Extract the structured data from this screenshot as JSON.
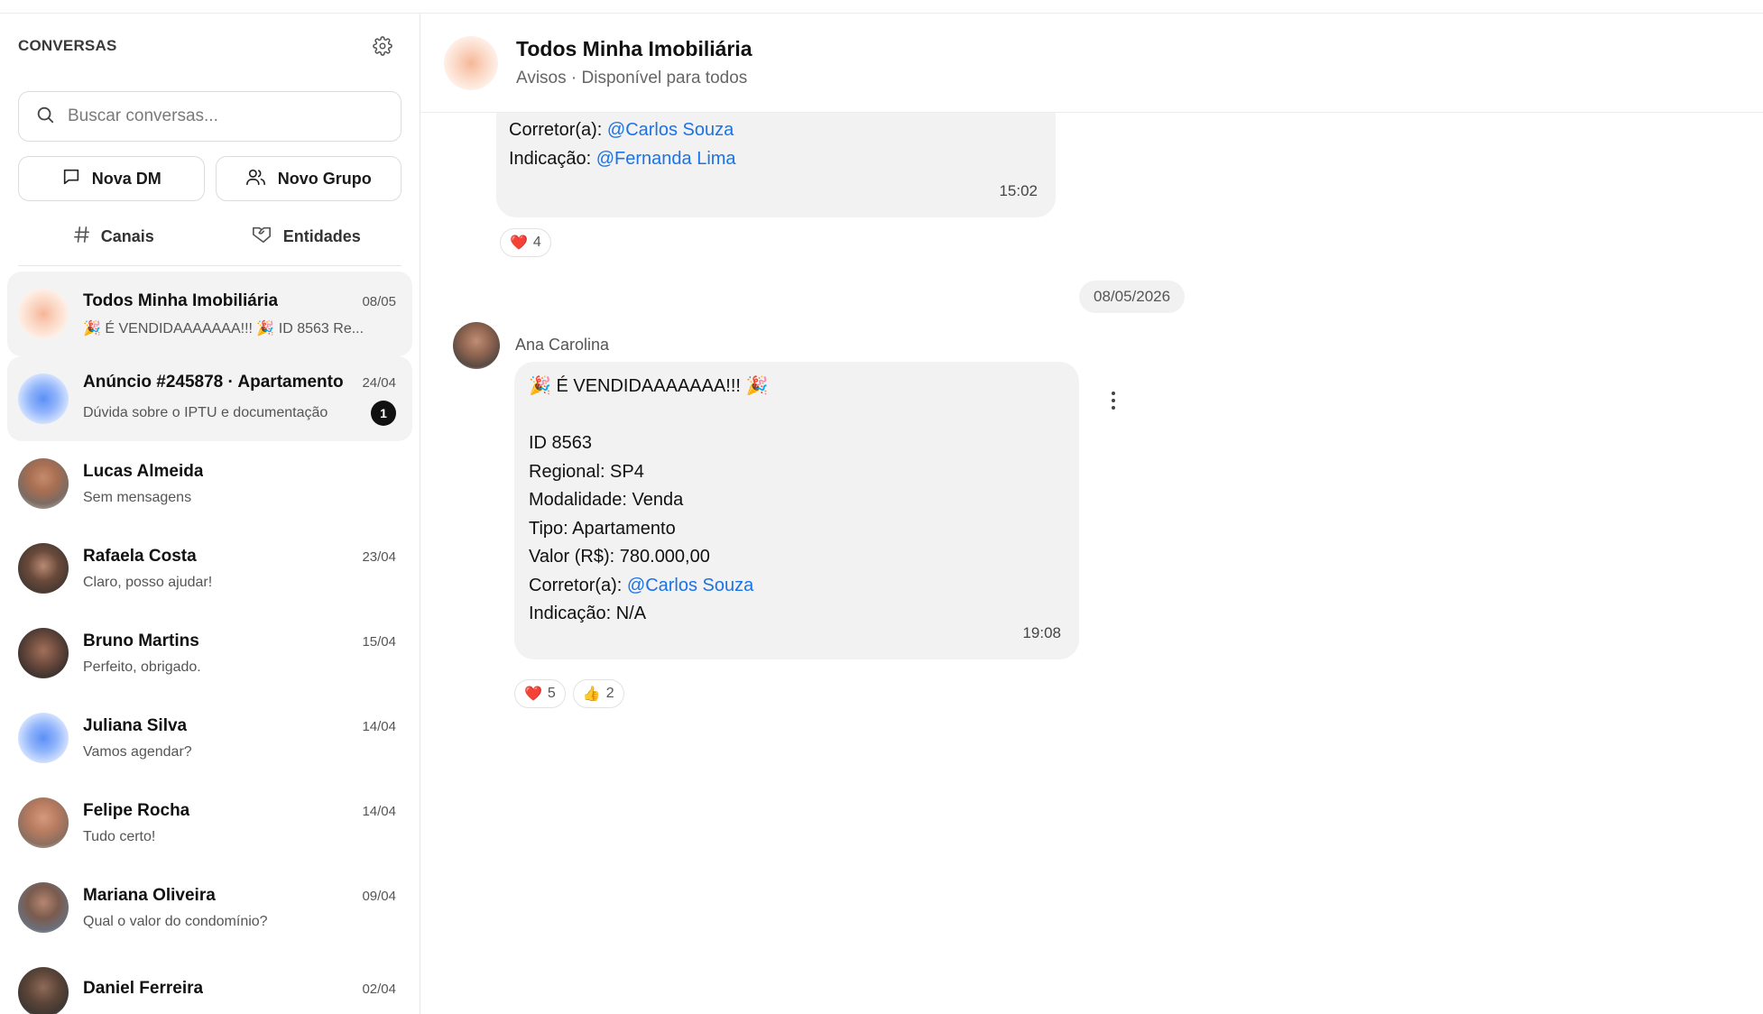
{
  "sidebar": {
    "title": "CONVERSAS",
    "search_placeholder": "Buscar conversas...",
    "new_dm_label": "Nova DM",
    "new_group_label": "Novo Grupo",
    "channels_label": "Canais",
    "entities_label": "Entidades",
    "conversations": [
      {
        "name": "Todos Minha Imobiliária",
        "time": "08/05",
        "preview": "🎉 É VENDIDAAAAAAA!!! 🎉 ID 8563 Re...",
        "badge": ""
      },
      {
        "name": "Anúncio #245878 · Apartamento",
        "time": "24/04",
        "preview": "Dúvida sobre o IPTU e documentação",
        "badge": "1"
      },
      {
        "name": "Lucas Almeida",
        "time": "",
        "preview": "Sem mensagens",
        "badge": ""
      },
      {
        "name": "Rafaela Costa",
        "time": "23/04",
        "preview": "Claro, posso ajudar!",
        "badge": ""
      },
      {
        "name": "Bruno Martins",
        "time": "15/04",
        "preview": "Perfeito, obrigado.",
        "badge": ""
      },
      {
        "name": "Juliana Silva",
        "time": "14/04",
        "preview": "Vamos agendar?",
        "badge": ""
      },
      {
        "name": "Felipe Rocha",
        "time": "14/04",
        "preview": "Tudo certo!",
        "badge": ""
      },
      {
        "name": "Mariana Oliveira",
        "time": "09/04",
        "preview": "Qual o valor do condomínio?",
        "badge": ""
      },
      {
        "name": "Daniel Ferreira",
        "time": "02/04",
        "preview": "",
        "badge": ""
      }
    ]
  },
  "chat": {
    "title": "Todos Minha Imobiliária",
    "subtitle": "Avisos · Disponível para todos",
    "msg1": {
      "broker_label": "Corretor(a): ",
      "broker_mention": "@Carlos Souza",
      "referral_label": "Indicação: ",
      "referral_mention": "@Fernanda Lima",
      "time": "15:02",
      "reactions": [
        {
          "emoji": "❤️",
          "count": "4"
        }
      ]
    },
    "date_divider": "08/05/2026",
    "msg2": {
      "sender": "Ana Carolina",
      "headline": "🎉 É VENDIDAAAAAAA!!! 🎉",
      "id_line": "ID 8563",
      "regional": "Regional: SP4",
      "modality": "Modalidade: Venda",
      "type": "Tipo: Apartamento",
      "value": "Valor (R$): 780.000,00",
      "broker_label": "Corretor(a): ",
      "broker_mention": "@Carlos Souza",
      "referral": "Indicação: N/A",
      "time": "19:08",
      "reactions": [
        {
          "emoji": "❤️",
          "count": "5"
        },
        {
          "emoji": "👍",
          "count": "2"
        }
      ]
    }
  }
}
